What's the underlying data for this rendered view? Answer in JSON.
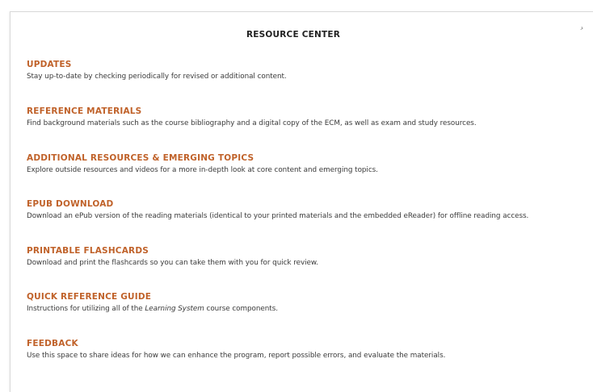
{
  "page": {
    "title": "RESOURCE CENTER",
    "close_glyph": "›"
  },
  "sections": [
    {
      "title": "UPDATES",
      "description": "Stay up-to-date by checking periodically for revised or additional content."
    },
    {
      "title": "REFERENCE MATERIALS",
      "description": "Find background materials such as the course bibliography and a digital copy of the ECM, as well as exam and study resources."
    },
    {
      "title": "ADDITIONAL RESOURCES & EMERGING TOPICS",
      "description": "Explore outside resources and videos for a more in-depth look at core content and emerging topics."
    },
    {
      "title": "EPUB DOWNLOAD",
      "description": "Download an ePub version of the reading materials (identical to your printed materials and the embedded eReader) for offline reading access."
    },
    {
      "title": "PRINTABLE FLASHCARDS",
      "description": "Download and print the flashcards so you can take them with you for quick review."
    },
    {
      "title": "QUICK REFERENCE GUIDE",
      "description_before": "Instructions for utilizing all of the ",
      "description_emphasis": "Learning System",
      "description_after": " course components."
    },
    {
      "title": "FEEDBACK",
      "description": "Use this space to share ideas for how we can enhance the program, report possible errors, and evaluate the materials."
    }
  ]
}
